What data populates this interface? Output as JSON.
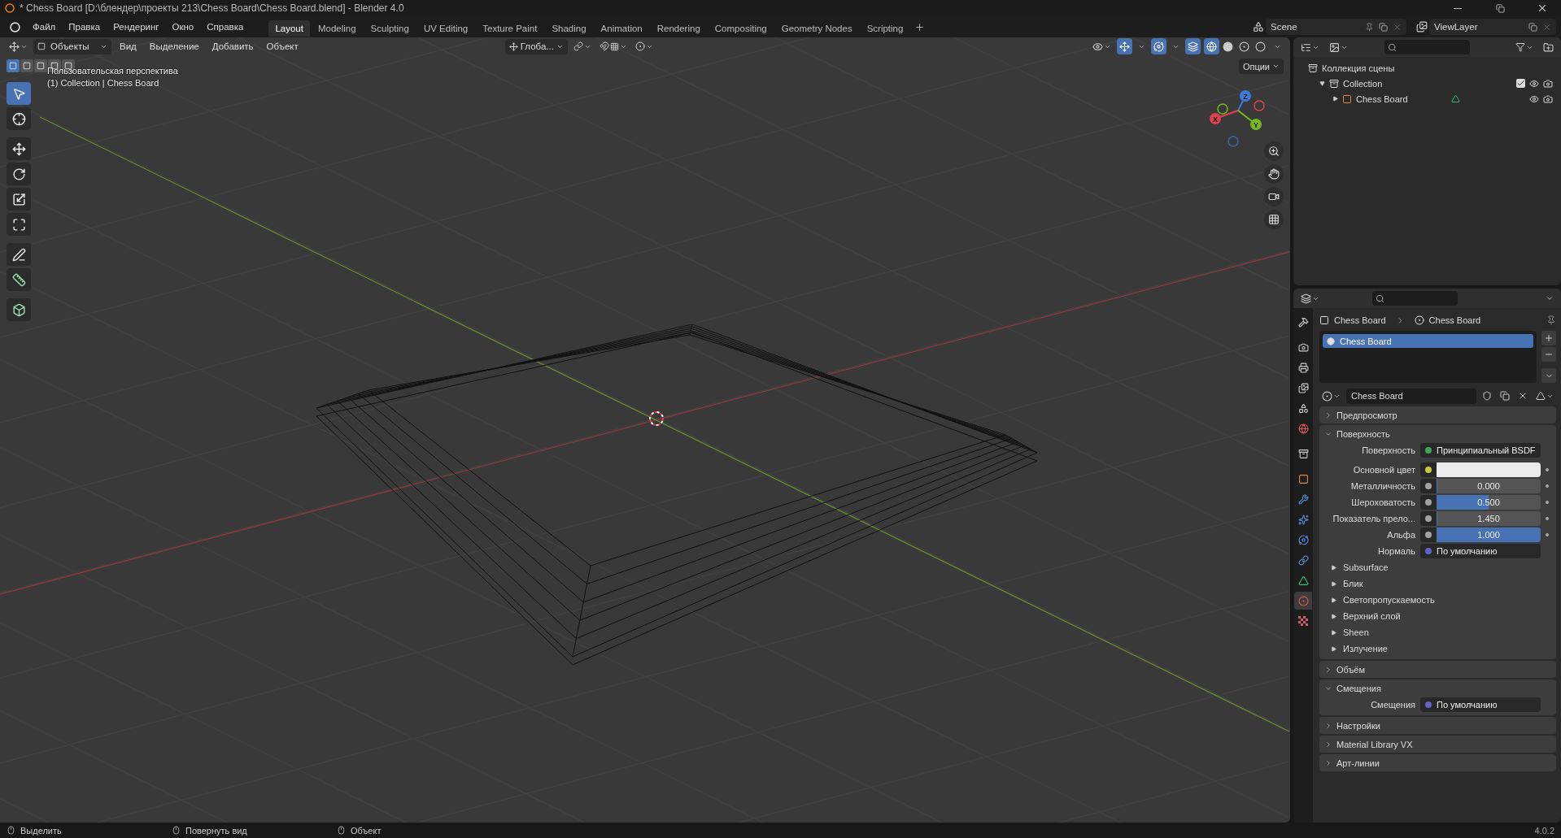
{
  "window": {
    "title": "* Chess Board [D:\\блендер\\проекты 213\\Chess Board\\Chess Board.blend] - Blender 4.0"
  },
  "menu": [
    "Файл",
    "Правка",
    "Рендеринг",
    "Окно",
    "Справка"
  ],
  "workspaces": [
    {
      "label": "Layout",
      "selected": true
    },
    {
      "label": "Modeling",
      "selected": false
    },
    {
      "label": "Sculpting",
      "selected": false
    },
    {
      "label": "UV Editing",
      "selected": false
    },
    {
      "label": "Texture Paint",
      "selected": false
    },
    {
      "label": "Shading",
      "selected": false
    },
    {
      "label": "Animation",
      "selected": false
    },
    {
      "label": "Rendering",
      "selected": false
    },
    {
      "label": "Compositing",
      "selected": false
    },
    {
      "label": "Geometry Nodes",
      "selected": false
    },
    {
      "label": "Scripting",
      "selected": false
    }
  ],
  "scene": "Scene",
  "view_layer": "ViewLayer",
  "viewport": {
    "mode": "Объекты",
    "menus": [
      "Вид",
      "Выделение",
      "Добавить",
      "Объект"
    ],
    "orientation": "Глоба...",
    "options": "Опции",
    "view_name": "Пользовательская перспектива",
    "context": "(1) Collection | Chess Board",
    "select_modes": [
      {
        "selected": true
      },
      {
        "selected": false
      },
      {
        "selected": false
      },
      {
        "selected": false
      },
      {
        "selected": false
      }
    ],
    "tools": [
      {
        "kind": "select",
        "selected": true
      },
      {
        "kind": "cursor",
        "selected": false
      },
      {
        "kind": "move",
        "selected": false
      },
      {
        "kind": "rotate",
        "selected": false
      },
      {
        "kind": "scale",
        "selected": false
      },
      {
        "kind": "transform",
        "selected": false
      },
      {
        "kind": "annotate",
        "selected": false
      },
      {
        "kind": "measure",
        "selected": false
      },
      {
        "kind": "add",
        "selected": false
      }
    ],
    "gizmo_axes": [
      {
        "label": "Z"
      },
      {
        "label": "X"
      },
      {
        "label": "Y"
      }
    ]
  },
  "outliner": {
    "root": "Коллекция сцены",
    "items": [
      {
        "label": "Collection",
        "expanded": true,
        "checked": true,
        "children": [
          {
            "label": "Chess Board",
            "expanded": false
          }
        ]
      }
    ]
  },
  "properties": {
    "tabs": [
      {
        "kind": "tool",
        "selected": false
      },
      {
        "kind": "render",
        "selected": false
      },
      {
        "kind": "output",
        "selected": false
      },
      {
        "kind": "view_layer",
        "selected": false
      },
      {
        "kind": "scene",
        "selected": false
      },
      {
        "kind": "world",
        "selected": false
      },
      {
        "kind": "collection",
        "selected": false
      },
      {
        "kind": "object",
        "selected": false
      },
      {
        "kind": "modifiers",
        "selected": false
      },
      {
        "kind": "particles",
        "selected": false
      },
      {
        "kind": "physics",
        "selected": false
      },
      {
        "kind": "constraints",
        "selected": false
      },
      {
        "kind": "data",
        "selected": false
      },
      {
        "kind": "material",
        "selected": true
      },
      {
        "kind": "texture",
        "selected": false
      }
    ],
    "breadcrumb": [
      "Chess Board",
      "Chess Board"
    ],
    "slots": [
      {
        "label": "Chess Board",
        "selected": true
      }
    ],
    "material_name": "Chess Board",
    "panels": [
      {
        "title": "Предпросмотр",
        "expanded": false
      },
      {
        "title": "Поверхность",
        "expanded": true,
        "rows": [
          {
            "kind": "link",
            "label": "Поверхность",
            "value": "Принципиальный BSDF",
            "color": "#3ea55a"
          },
          {
            "kind": "swatch",
            "label": "Основной цвет",
            "color": "#ececec"
          },
          {
            "kind": "slider",
            "label": "Металличность",
            "value": "0.000",
            "level": 0
          },
          {
            "kind": "slider",
            "label": "Шероховатость",
            "value": "0.500",
            "level": 0.5
          },
          {
            "kind": "slider",
            "label": "Показатель прело...",
            "value": "1.450",
            "level": 0
          },
          {
            "kind": "slider",
            "label": "Альфа",
            "value": "1.000",
            "level": 1
          },
          {
            "kind": "link",
            "label": "Нормаль",
            "value": "По умолчанию",
            "color": "#6363c7"
          }
        ],
        "subpanels": [
          "Subsurface",
          "Блик",
          "Светопропускаемость",
          "Верхний слой",
          "Sheen",
          "Излучение"
        ]
      },
      {
        "title": "Объём",
        "expanded": false
      },
      {
        "title": "Смещения",
        "expanded": true,
        "rows": [
          {
            "kind": "link",
            "label": "Смещения",
            "value": "По умолчанию",
            "color": "#6363c7"
          }
        ]
      },
      {
        "title": "Настройки",
        "expanded": false
      },
      {
        "title": "Material Library VX",
        "expanded": false
      },
      {
        "title": "Арт-линии",
        "expanded": false
      }
    ]
  },
  "status_bar": {
    "hints": [
      "Выделить",
      "Повернуть вид",
      "Объект"
    ],
    "version": "4.0.2"
  }
}
